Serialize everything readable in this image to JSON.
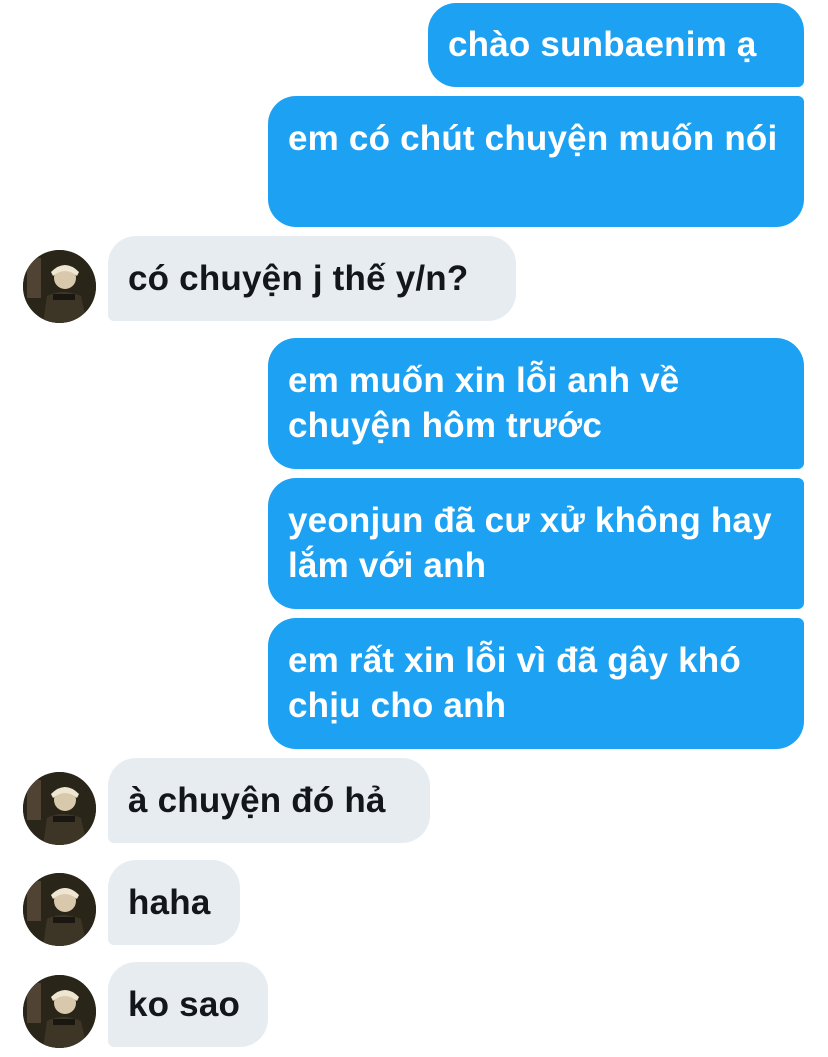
{
  "messages": [
    {
      "direction": "outgoing",
      "text": "chào sunbaenim ạ"
    },
    {
      "direction": "outgoing",
      "text": "em có chút chuyện muốn nói"
    },
    {
      "direction": "incoming",
      "text": "có chuyện j thế y/n?"
    },
    {
      "direction": "outgoing",
      "text": "em muốn xin lỗi anh về chuyện hôm trước"
    },
    {
      "direction": "outgoing",
      "text": "yeonjun đã cư xử không hay lắm với anh"
    },
    {
      "direction": "outgoing",
      "text": "em rất xin lỗi vì đã gây khó chịu cho anh"
    },
    {
      "direction": "incoming",
      "text": "à chuyện đó hả"
    },
    {
      "direction": "incoming",
      "text": "haha"
    },
    {
      "direction": "incoming",
      "text": "ko sao"
    }
  ],
  "colors": {
    "outgoing_bubble": "#1da1f2",
    "incoming_bubble": "#e6ecf0",
    "incoming_text": "#14171a",
    "outgoing_text": "#ffffff"
  },
  "icons": {
    "avatar": "contact-avatar-photo"
  }
}
